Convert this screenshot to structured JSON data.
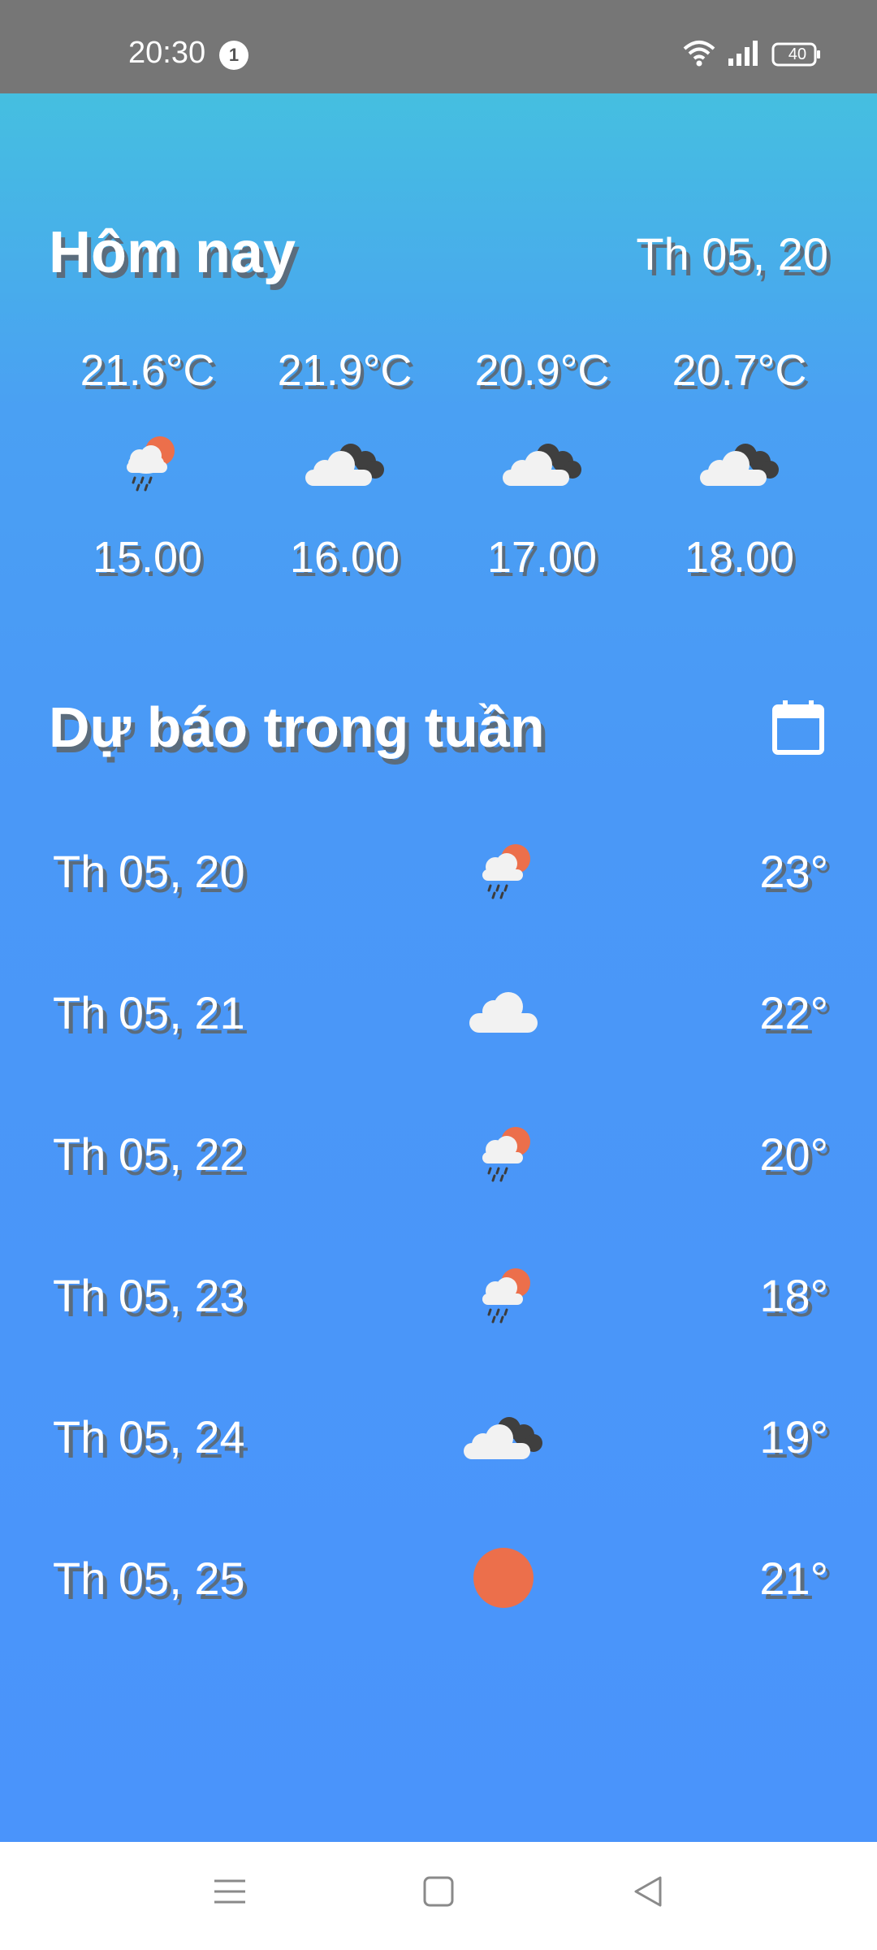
{
  "status_bar": {
    "time": "20:30",
    "notification_count": "1",
    "battery": "40"
  },
  "today": {
    "title": "Hôm nay",
    "date": "Th 05, 20",
    "hours": [
      {
        "temp": "21.6°C",
        "icon": "rain-sun-icon",
        "time": "15.00"
      },
      {
        "temp": "21.9°C",
        "icon": "cloudy-icon",
        "time": "16.00"
      },
      {
        "temp": "20.9°C",
        "icon": "cloudy-icon",
        "time": "17.00"
      },
      {
        "temp": "20.7°C",
        "icon": "cloudy-icon",
        "time": "18.00"
      }
    ]
  },
  "week": {
    "title": "Dự báo trong tuần",
    "days": [
      {
        "date": "Th 05, 20",
        "icon": "rain-sun-icon",
        "temp": "23°"
      },
      {
        "date": "Th 05, 21",
        "icon": "cloud-icon",
        "temp": "22°"
      },
      {
        "date": "Th 05, 22",
        "icon": "rain-sun-icon",
        "temp": "20°"
      },
      {
        "date": "Th 05, 23",
        "icon": "rain-sun-icon",
        "temp": "18°"
      },
      {
        "date": "Th 05, 24",
        "icon": "cloudy-icon",
        "temp": "19°"
      },
      {
        "date": "Th 05, 25",
        "icon": "sun-icon",
        "temp": "21°"
      }
    ]
  },
  "colors": {
    "status_bar": "#767676",
    "gradient_top": "#45bfe0",
    "gradient_bottom": "#4a94fb",
    "sun": "#ec6f4b"
  }
}
